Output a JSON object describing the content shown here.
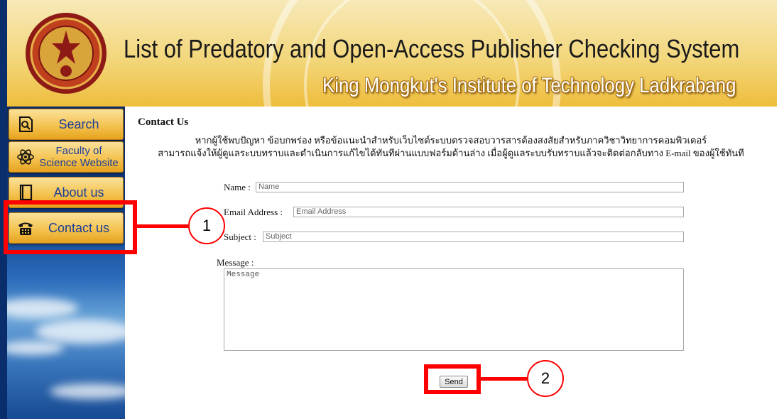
{
  "header": {
    "title": "List of Predatory and Open-Access Publisher Checking System",
    "subtitle": "King Mongkut's Institute of Technology Ladkrabang"
  },
  "sidebar": {
    "items": [
      {
        "label": "Search",
        "icon": "search-document-icon"
      },
      {
        "label": "Faculty of Science Website",
        "icon": "atom-icon"
      },
      {
        "label": "About us",
        "icon": "book-icon"
      },
      {
        "label": "Contact us",
        "icon": "telephone-icon"
      }
    ]
  },
  "main": {
    "heading": "Contact Us",
    "description_line1": "หากผู้ใช้พบปัญหา ข้อบกพร่อง หรือข้อแนะนำสำหรับเว็บไซต์ระบบตรวจสอบวารสารต้องสงสัยสำหรับภาควิชาวิทยาการคอมพิวเตอร์",
    "description_line2": "สามารถแจ้งให้ผู้ดูแลระบบทราบและดำเนินการแก้ไขได้ทันทีผ่านแบบฟอร์มด้านล่าง เมื่อผู้ดูแลระบบรับทราบแล้วจะติดต่อกลับทาง E-mail ของผู้ใช้ทันที",
    "form": {
      "name_label": "Name :",
      "name_placeholder": "Name",
      "email_label": "Email Address :",
      "email_placeholder": "Email Address",
      "subject_label": "Subject :",
      "subject_placeholder": "Subject",
      "message_label": "Message :",
      "message_placeholder": "Message",
      "send_label": "Send"
    }
  },
  "annotations": {
    "callout_1": "1",
    "callout_2": "2",
    "color": "#ff0000"
  },
  "colors": {
    "header_gold": "#f3d77c",
    "nav_button": "#f3c04a",
    "nav_text": "#1d3f9a",
    "sidebar_blue": "#123d84"
  }
}
